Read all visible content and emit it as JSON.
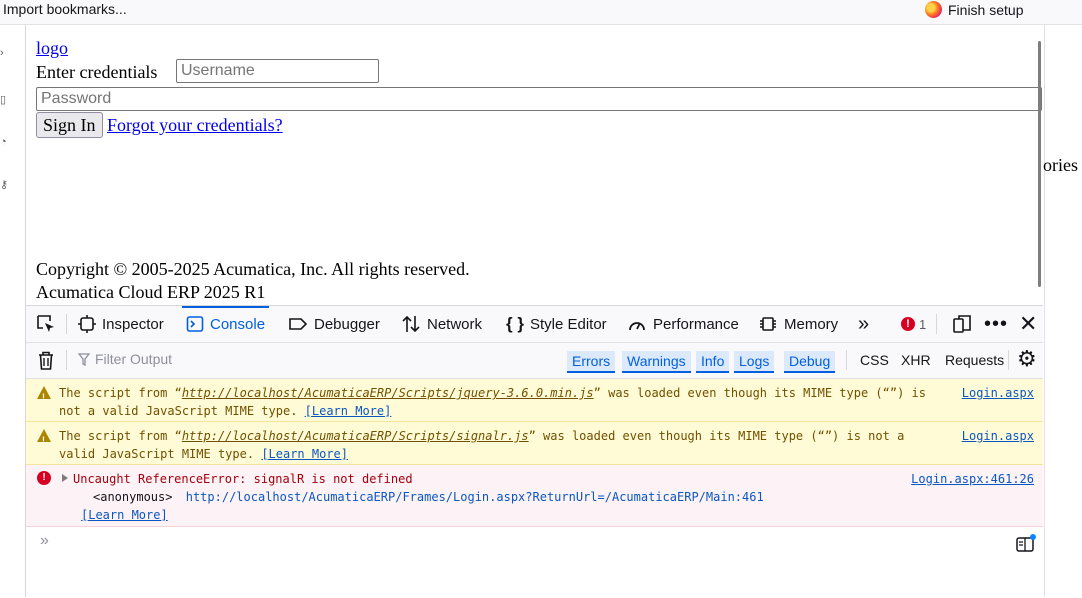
{
  "bookmarks_bar": {
    "import_label": "Import bookmarks...",
    "finish_label": "Finish setup"
  },
  "right_fragment": "ories",
  "login": {
    "logo_text": "logo",
    "credentials_label": "Enter credentials",
    "username_placeholder": "Username",
    "password_placeholder": "Password",
    "signin_label": "Sign In",
    "forgot_label": "Forgot your credentials?",
    "copyright": "Copyright © 2005-2025 Acumatica, Inc. All rights reserved.",
    "version": "Acumatica Cloud ERP 2025 R1"
  },
  "devtools": {
    "tabs": [
      {
        "label": "Inspector",
        "icon": "inspector-icon"
      },
      {
        "label": "Console",
        "icon": "console-icon",
        "selected": true
      },
      {
        "label": "Debugger",
        "icon": "debugger-icon"
      },
      {
        "label": "Network",
        "icon": "network-icon"
      },
      {
        "label": "Style Editor",
        "icon": "style-editor-icon"
      },
      {
        "label": "Performance",
        "icon": "performance-icon"
      },
      {
        "label": "Memory",
        "icon": "memory-icon"
      }
    ],
    "error_count": "1",
    "filter_placeholder": "Filter Output",
    "filters": [
      "Errors",
      "Warnings",
      "Info",
      "Logs",
      "Debug"
    ],
    "extra_filters": [
      "CSS",
      "XHR",
      "Requests"
    ],
    "messages": [
      {
        "level": "warning",
        "text_before": "The script from “",
        "file": "http://localhost/AcumaticaERP/Scripts/jquery-3.6.0.min.js",
        "text_after": "” was loaded even though its MIME type (“”) is not a valid JavaScript MIME type.",
        "learn_more": "[Learn More]",
        "location": "Login.aspx"
      },
      {
        "level": "warning",
        "text_before": "The script from “",
        "file": "http://localhost/AcumaticaERP/Scripts/signalr.js",
        "text_after": "” was loaded even though its MIME type (“”) is not a valid JavaScript MIME type.",
        "learn_more": "[Learn More]",
        "location": "Login.aspx"
      },
      {
        "level": "error",
        "text": "Uncaught ReferenceError: signalR is not defined",
        "frame_fn": "<anonymous>",
        "frame_url": "http://localhost/AcumaticaERP/Frames/Login.aspx?ReturnUrl=/AcumaticaERP/Main:461",
        "learn_more": "[Learn More]",
        "location": "Login.aspx:461:26"
      }
    ],
    "colors": {
      "accent": "#0060df",
      "warning_bg": "#fffbd6",
      "error_bg": "#fdf2f5",
      "error": "#d70022"
    }
  }
}
